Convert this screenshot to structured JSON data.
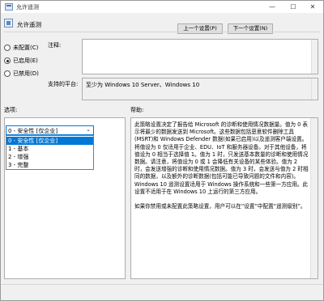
{
  "window": {
    "title": "允许遥测",
    "controls": {
      "minimize": "—",
      "maximize": "☐",
      "close": "✕"
    }
  },
  "header": {
    "title": "允许遥测"
  },
  "nav": {
    "prev_label": "上一个设置(P)",
    "next_label": "下一个设置(N)"
  },
  "state": {
    "options": [
      "未配置(C)",
      "已启用(E)",
      "已禁用(D)"
    ],
    "selected": "已启用(E)"
  },
  "comment": {
    "label": "注释:",
    "value": ""
  },
  "support": {
    "label": "支持的平台:",
    "value": "至少为 Windows 10 Server、Windows 10"
  },
  "options_panel": {
    "label": "选项:",
    "select_value": "0 - 安全性 [仅企业]",
    "dropdown_items": [
      "0 - 安全性 [仅企业]",
      "1 - 基本",
      "2 - 增强",
      "3 - 完整"
    ],
    "selected_index": 0
  },
  "help_panel": {
    "label": "帮助:",
    "text": "此策略设置决定了报告给 Microsoft 的诊断和使用情况数据量。值为 0 表示将最少的数据发送到 Microsoft。这些数据包括恶意软件删除工具(MSRT)和 Windows Defender 数据(如果已启用)以及遥测客户端设置。将值设为 0 仅适用于企业、EDU、IoT 和服务器设备。对于其他设备，将值设为 0 相当于选择值 1。值为 1 时，只发送基本数量的诊断和使用情况数据。请注意，将值设为 0 或 1 会降低有关设备的某些体验。值为 2 时，会发送增强的诊断和使用情况数据。值为 3 时，会发送与值为 2 时相同的数据，以及额外的诊断数据(包括可能已导致问题的文件和内容)。Windows 10 遥测设置适用于 Windows 操作系统和一些第一方应用。此设置不适用于在 Windows 10 上运行的第三方应用。\n\n如果你禁用或未配置此策略设置，用户可以在“设置”中配置“遥测级别”。"
  }
}
